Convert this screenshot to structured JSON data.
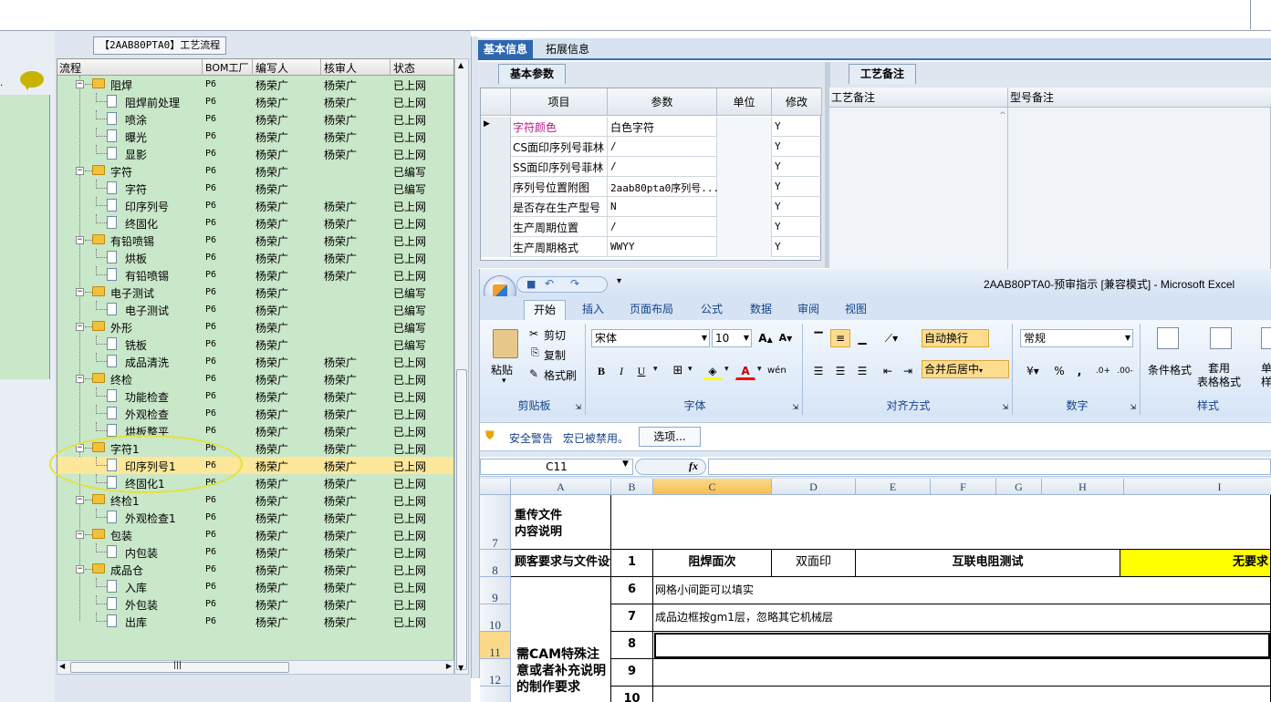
{
  "tree": {
    "title": "【2AAB80PTA0】工艺流程",
    "columns": [
      "流程",
      "BOM工厂",
      "编写人",
      "核审人",
      "状态"
    ],
    "rows": [
      {
        "name": "阻焊",
        "type": "folder",
        "bom": "P6",
        "writer": "杨荣广",
        "reviewer": "杨荣广",
        "status": "已上网"
      },
      {
        "name": "阻焊前处理",
        "type": "file",
        "bom": "P6",
        "writer": "杨荣广",
        "reviewer": "杨荣广",
        "status": "已上网"
      },
      {
        "name": "喷涂",
        "type": "file",
        "bom": "P6",
        "writer": "杨荣广",
        "reviewer": "杨荣广",
        "status": "已上网"
      },
      {
        "name": "曝光",
        "type": "file",
        "bom": "P6",
        "writer": "杨荣广",
        "reviewer": "杨荣广",
        "status": "已上网"
      },
      {
        "name": "显影",
        "type": "file",
        "bom": "P6",
        "writer": "杨荣广",
        "reviewer": "杨荣广",
        "status": "已上网"
      },
      {
        "name": "字符",
        "type": "folder",
        "bom": "P6",
        "writer": "杨荣广",
        "reviewer": "",
        "status": "已编写"
      },
      {
        "name": "字符",
        "type": "file",
        "bom": "P6",
        "writer": "杨荣广",
        "reviewer": "",
        "status": "已编写"
      },
      {
        "name": "印序列号",
        "type": "file",
        "bom": "P6",
        "writer": "杨荣广",
        "reviewer": "杨荣广",
        "status": "已上网"
      },
      {
        "name": "终固化",
        "type": "file",
        "bom": "P6",
        "writer": "杨荣广",
        "reviewer": "杨荣广",
        "status": "已上网"
      },
      {
        "name": "有铅喷锡",
        "type": "folder",
        "bom": "P6",
        "writer": "杨荣广",
        "reviewer": "杨荣广",
        "status": "已上网"
      },
      {
        "name": "烘板",
        "type": "file",
        "bom": "P6",
        "writer": "杨荣广",
        "reviewer": "杨荣广",
        "status": "已上网"
      },
      {
        "name": "有铅喷锡",
        "type": "file",
        "bom": "P6",
        "writer": "杨荣广",
        "reviewer": "杨荣广",
        "status": "已上网"
      },
      {
        "name": "电子测试",
        "type": "folder",
        "bom": "P6",
        "writer": "杨荣广",
        "reviewer": "",
        "status": "已编写"
      },
      {
        "name": "电子测试",
        "type": "file",
        "bom": "P6",
        "writer": "杨荣广",
        "reviewer": "",
        "status": "已编写"
      },
      {
        "name": "外形",
        "type": "folder",
        "bom": "P6",
        "writer": "杨荣广",
        "reviewer": "",
        "status": "已编写"
      },
      {
        "name": "铣板",
        "type": "file",
        "bom": "P6",
        "writer": "杨荣广",
        "reviewer": "",
        "status": "已编写"
      },
      {
        "name": "成品清洗",
        "type": "file",
        "bom": "P6",
        "writer": "杨荣广",
        "reviewer": "杨荣广",
        "status": "已上网"
      },
      {
        "name": "终检",
        "type": "folder",
        "bom": "P6",
        "writer": "杨荣广",
        "reviewer": "杨荣广",
        "status": "已上网"
      },
      {
        "name": "功能检查",
        "type": "file",
        "bom": "P6",
        "writer": "杨荣广",
        "reviewer": "杨荣广",
        "status": "已上网"
      },
      {
        "name": "外观检查",
        "type": "file",
        "bom": "P6",
        "writer": "杨荣广",
        "reviewer": "杨荣广",
        "status": "已上网"
      },
      {
        "name": "烘板整平",
        "type": "file",
        "bom": "P6",
        "writer": "杨荣广",
        "reviewer": "杨荣广",
        "status": "已上网"
      },
      {
        "name": "字符1",
        "type": "folder",
        "bom": "P6",
        "writer": "杨荣广",
        "reviewer": "杨荣广",
        "status": "已上网"
      },
      {
        "name": "印序列号1",
        "type": "file",
        "bom": "P6",
        "writer": "杨荣广",
        "reviewer": "杨荣广",
        "status": "已上网",
        "selected": true
      },
      {
        "name": "终固化1",
        "type": "file",
        "bom": "P6",
        "writer": "杨荣广",
        "reviewer": "杨荣广",
        "status": "已上网"
      },
      {
        "name": "终检1",
        "type": "folder",
        "bom": "P6",
        "writer": "杨荣广",
        "reviewer": "杨荣广",
        "status": "已上网"
      },
      {
        "name": "外观检查1",
        "type": "file",
        "bom": "P6",
        "writer": "杨荣广",
        "reviewer": "杨荣广",
        "status": "已上网"
      },
      {
        "name": "包装",
        "type": "folder",
        "bom": "P6",
        "writer": "杨荣广",
        "reviewer": "杨荣广",
        "status": "已上网"
      },
      {
        "name": "内包装",
        "type": "file",
        "bom": "P6",
        "writer": "杨荣广",
        "reviewer": "杨荣广",
        "status": "已上网"
      },
      {
        "name": "成品仓",
        "type": "folder",
        "bom": "P6",
        "writer": "杨荣广",
        "reviewer": "杨荣广",
        "status": "已上网"
      },
      {
        "name": "入库",
        "type": "file",
        "bom": "P6",
        "writer": "杨荣广",
        "reviewer": "杨荣广",
        "status": "已上网"
      },
      {
        "name": "外包装",
        "type": "file",
        "bom": "P6",
        "writer": "杨荣广",
        "reviewer": "杨荣广",
        "status": "已上网"
      },
      {
        "name": "出库",
        "type": "file",
        "bom": "P6",
        "writer": "杨荣广",
        "reviewer": "杨荣广",
        "status": "已上网"
      }
    ],
    "hscroll_mark": "|||"
  },
  "info": {
    "tabs": [
      "基本信息",
      "拓展信息"
    ],
    "subtab_basic": "基本参数",
    "subtab_remarks": "工艺备注",
    "param_headers": [
      "项目",
      "参数",
      "单位",
      "修改"
    ],
    "params": [
      {
        "item": "字符颜色",
        "value": "白色字符",
        "unit": "",
        "mod": "Y"
      },
      {
        "item": "CS面印序列号菲林",
        "value": "/",
        "unit": "",
        "mod": "Y"
      },
      {
        "item": "SS面印序列号菲林",
        "value": "/",
        "unit": "",
        "mod": "Y"
      },
      {
        "item": "序列号位置附图",
        "value": "2aab80pta0序列号...",
        "unit": "",
        "mod": "Y"
      },
      {
        "item": "是否存在生产型号",
        "value": "N",
        "unit": "",
        "mod": "Y"
      },
      {
        "item": "生产周期位置",
        "value": "/",
        "unit": "",
        "mod": "Y"
      },
      {
        "item": "生产周期格式",
        "value": "WWYY",
        "unit": "",
        "mod": "Y"
      }
    ],
    "remark_headers": [
      "工艺备注",
      "型号备注"
    ]
  },
  "excel": {
    "title": "2AAB80PTA0-预审指示 [兼容模式] - Microsoft Excel",
    "tabs": [
      "开始",
      "插入",
      "页面布局",
      "公式",
      "数据",
      "审阅",
      "视图"
    ],
    "clipboard": {
      "paste": "粘贴",
      "cut": "剪切",
      "copy": "复制",
      "format_painter": "格式刷",
      "label": "剪贴板"
    },
    "font": {
      "name": "宋体",
      "size": "10",
      "grow": "A",
      "shrink": "A",
      "bold": "B",
      "italic": "I",
      "underline": "U",
      "label": "字体"
    },
    "alignment": {
      "wrap": "自动换行",
      "merge": "合并后居中",
      "label": "对齐方式"
    },
    "number": {
      "format": "常规",
      "percent": "%",
      "comma": ",",
      "label": "数字"
    },
    "styles": {
      "conditional": "条件格式",
      "table": "套用\n表格格式",
      "cell": "单元\n样式",
      "label": "样式"
    },
    "security": {
      "warning": "安全警告",
      "message": "宏已被禁用。",
      "options": "选项..."
    },
    "name_box": "C11",
    "fx": "fx",
    "columns": [
      "A",
      "B",
      "C",
      "D",
      "E",
      "F",
      "G",
      "H",
      "I"
    ],
    "rows": [
      {
        "num": "7",
        "a": "重传文件\n内容说明"
      },
      {
        "num": "8",
        "a": "顾客要求与文件设计不一致",
        "b": "1",
        "c": "阻焊面次",
        "d": "双面印",
        "e": "互联电阻测试",
        "i": "无要求"
      },
      {
        "num": "9",
        "b": "6",
        "c": "网格小间距可以填实"
      },
      {
        "num": "10",
        "b": "7",
        "c": "成品边框按gm1层，忽略其它机械层"
      },
      {
        "num": "11",
        "b": "8",
        "c": ""
      },
      {
        "num": "12",
        "b": "9",
        "c": ""
      },
      {
        "num": "13",
        "b": "10",
        "c": ""
      }
    ],
    "merged_a": "需CAM特殊注意或者补充说明的制作要求",
    "highlight_color": "#ffff00"
  }
}
